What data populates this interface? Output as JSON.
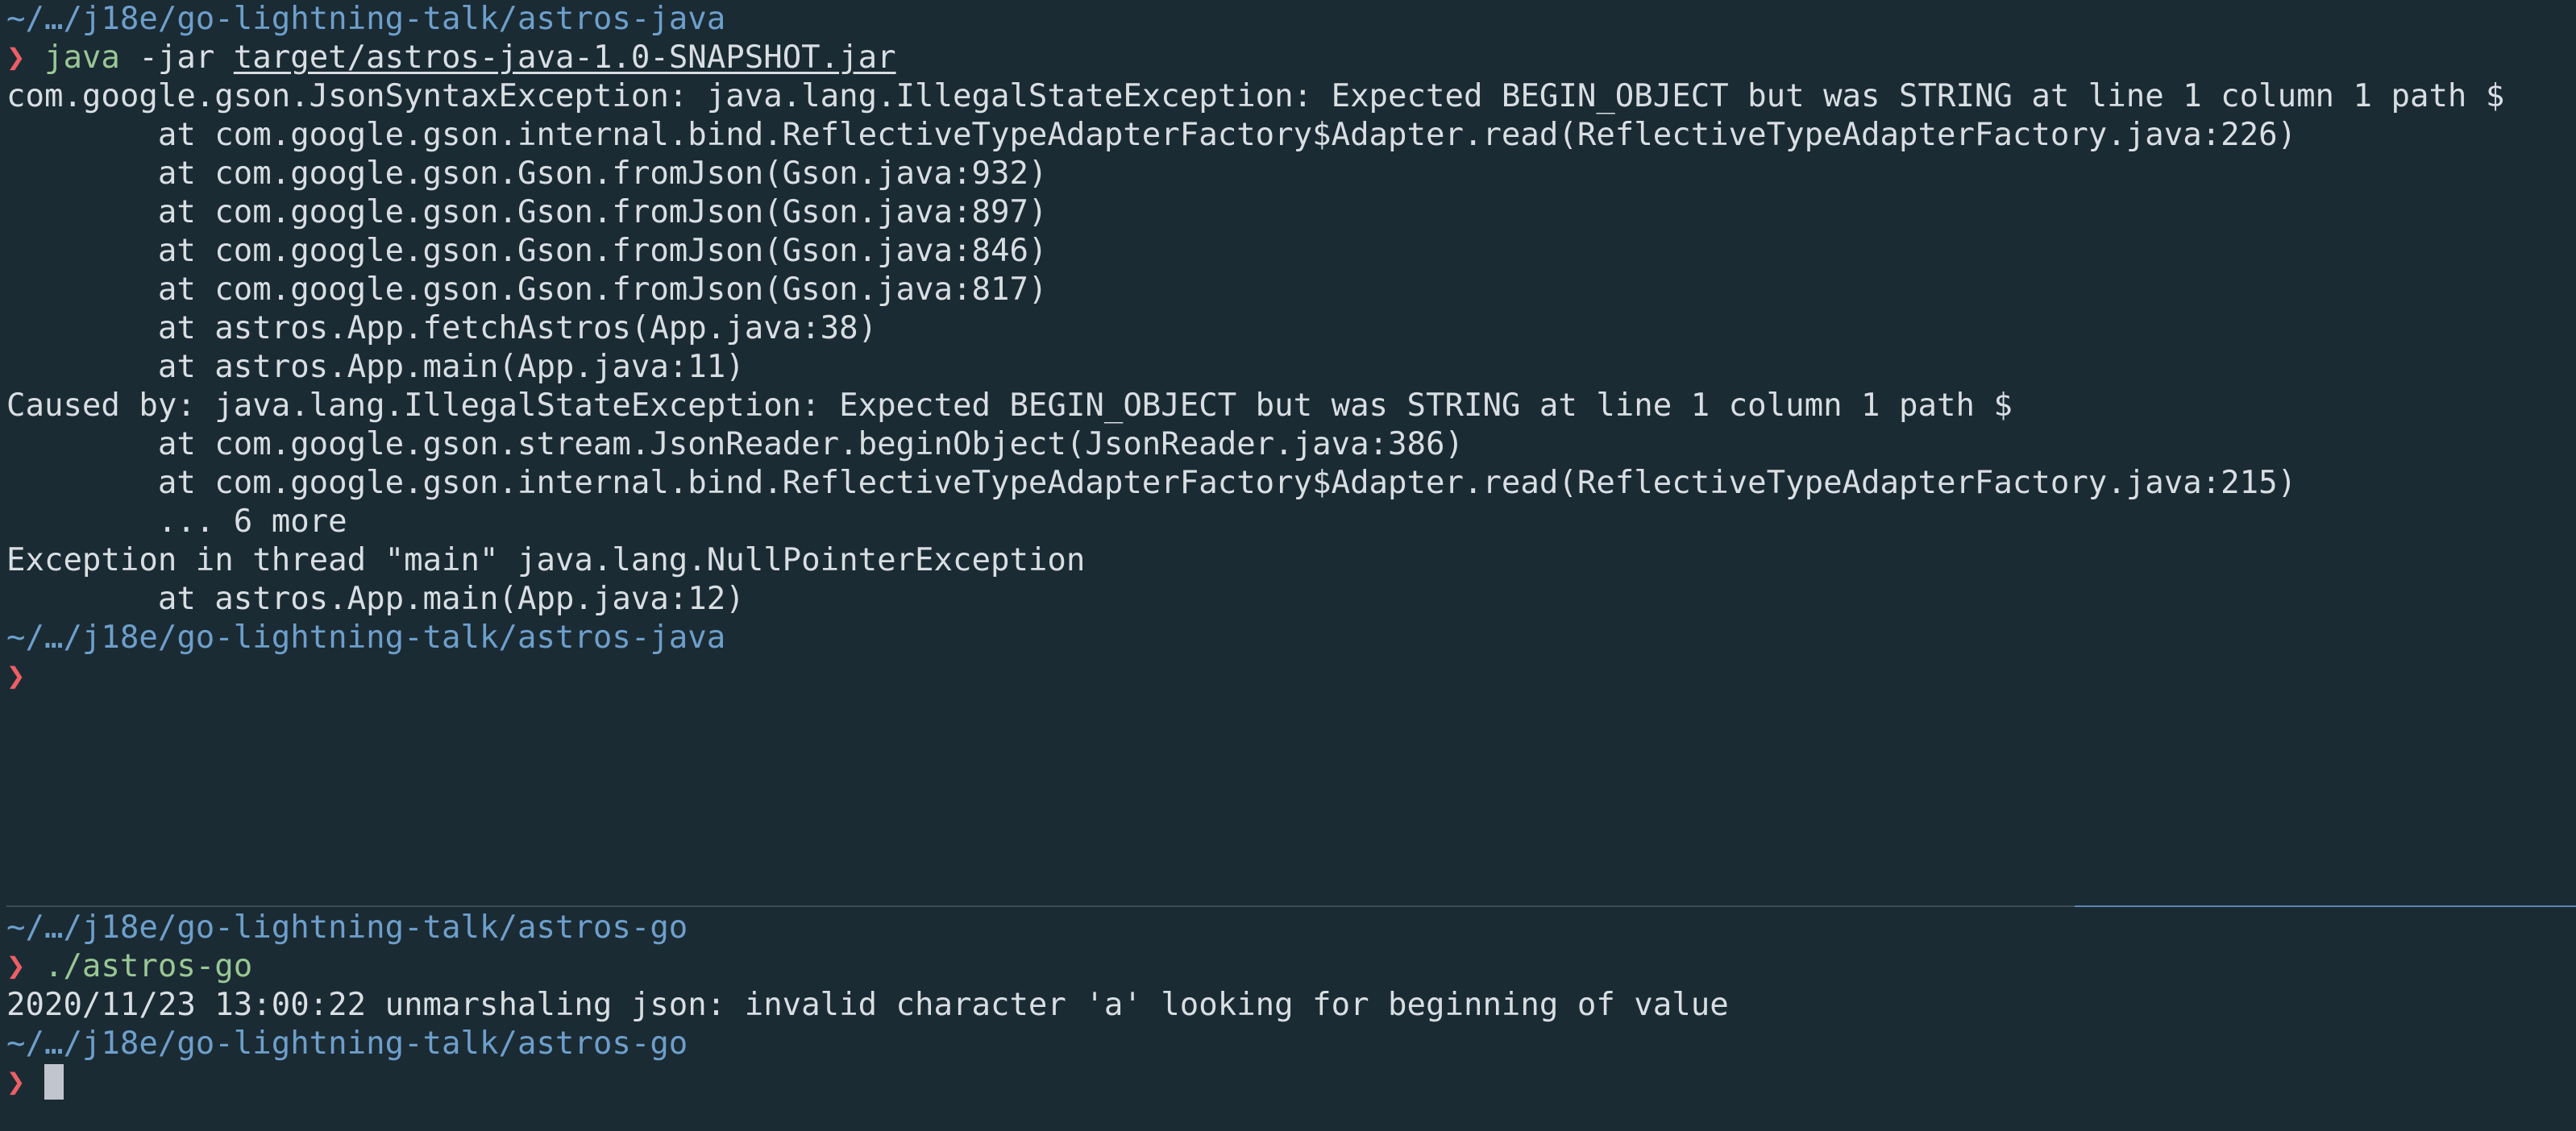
{
  "top_pane": {
    "cwd": "~/…/j18e/go-lightning-talk/astros-java",
    "prompt_symbol": "❯",
    "command": {
      "program": "java",
      "flag": "-jar",
      "file": "target/astros-java-1.0-SNAPSHOT.jar"
    },
    "output": [
      "com.google.gson.JsonSyntaxException: java.lang.IllegalStateException: Expected BEGIN_OBJECT but was STRING at line 1 column 1 path $",
      "        at com.google.gson.internal.bind.ReflectiveTypeAdapterFactory$Adapter.read(ReflectiveTypeAdapterFactory.java:226)",
      "        at com.google.gson.Gson.fromJson(Gson.java:932)",
      "        at com.google.gson.Gson.fromJson(Gson.java:897)",
      "        at com.google.gson.Gson.fromJson(Gson.java:846)",
      "        at com.google.gson.Gson.fromJson(Gson.java:817)",
      "        at astros.App.fetchAstros(App.java:38)",
      "        at astros.App.main(App.java:11)",
      "Caused by: java.lang.IllegalStateException: Expected BEGIN_OBJECT but was STRING at line 1 column 1 path $",
      "        at com.google.gson.stream.JsonReader.beginObject(JsonReader.java:386)",
      "        at com.google.gson.internal.bind.ReflectiveTypeAdapterFactory$Adapter.read(ReflectiveTypeAdapterFactory.java:215)",
      "        ... 6 more",
      "Exception in thread \"main\" java.lang.NullPointerException",
      "        at astros.App.main(App.java:12)"
    ],
    "cwd_after": "~/…/j18e/go-lightning-talk/astros-java"
  },
  "bottom_pane": {
    "cwd": "~/…/j18e/go-lightning-talk/astros-go",
    "prompt_symbol": "❯",
    "command": "./astros-go",
    "output": [
      "2020/11/23 13:00:22 unmarshaling json: invalid character 'a' looking for beginning of value"
    ],
    "cwd_after": "~/…/j18e/go-lightning-talk/astros-go"
  },
  "colors": {
    "background": "#1b2b34",
    "path": "#6e9fcb",
    "prompt": "#ec5f67",
    "command": "#99c794",
    "text": "#d8dee2",
    "active_pane_border": "#5a86b0"
  }
}
